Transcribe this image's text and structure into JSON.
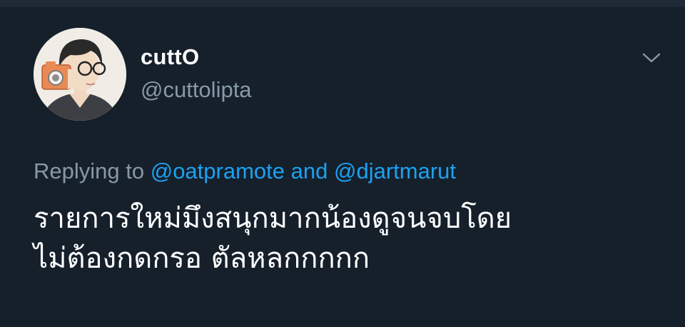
{
  "user": {
    "display_name": "cuttO",
    "handle": "@cuttolipta"
  },
  "reply": {
    "prefix": "Replying to",
    "mentions": [
      "@oatpramote",
      "@djartmarut"
    ],
    "conjunction": "and"
  },
  "tweet": {
    "text_lines": [
      "รายการใหม่มึงสนุกมากน้องดูจนจบโดย",
      "ไม่ต้องกดกรอ ตัลหลกกกกก"
    ]
  },
  "icons": {
    "menu": "chevron-down-icon",
    "avatar": "avatar-illustration"
  },
  "colors": {
    "background": "#15202b",
    "divider": "#1f2a36",
    "primary_text": "#ffffff",
    "secondary_text": "#8899a6",
    "accent": "#1da1f2"
  }
}
